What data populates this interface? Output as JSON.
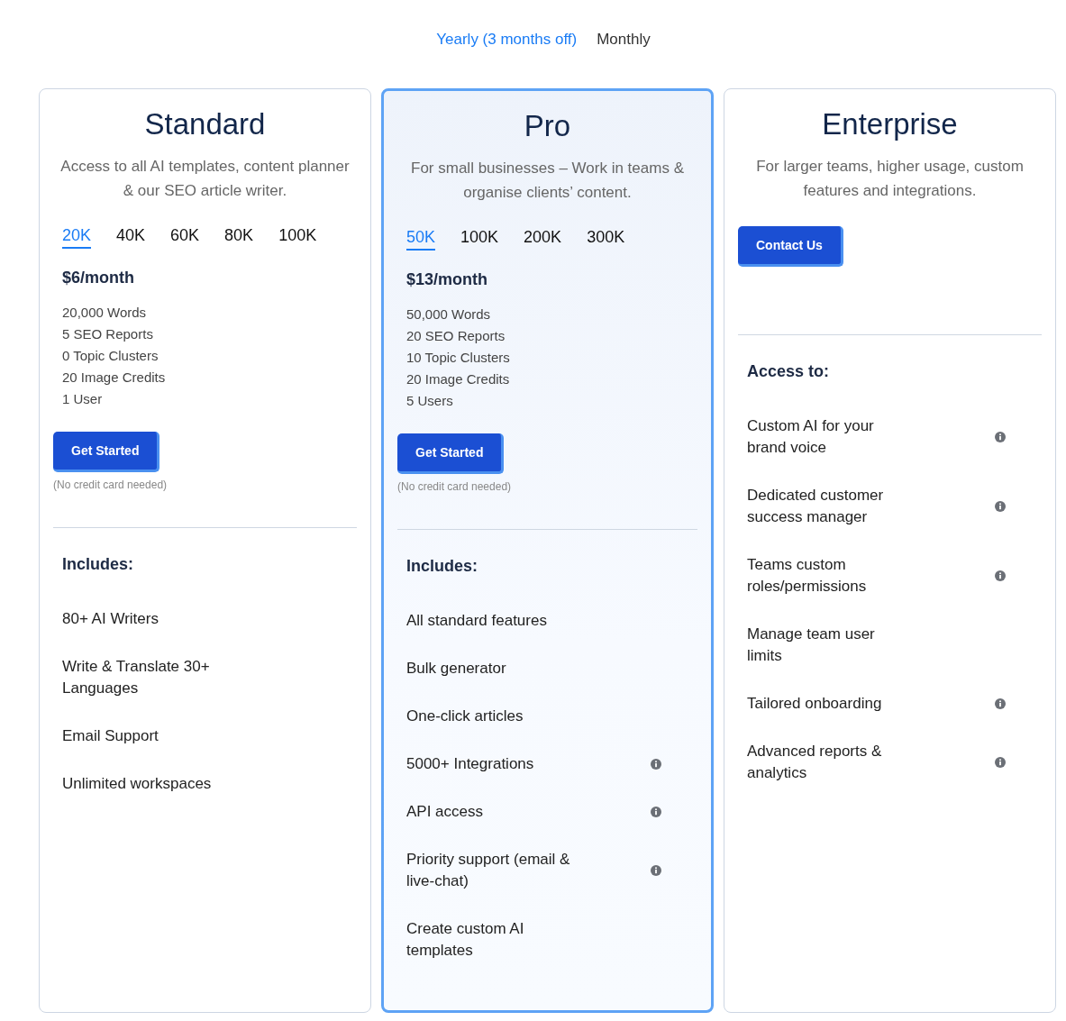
{
  "billing": [
    {
      "label": "Yearly (3 months off)",
      "selected": true
    },
    {
      "label": "Monthly",
      "selected": false
    }
  ],
  "plans": [
    {
      "name": "Standard",
      "featured": false,
      "description": "Access to all AI templates, content planner & our SEO article writer.",
      "tiers": [
        {
          "label": "20K",
          "selected": true
        },
        {
          "label": "40K",
          "selected": false
        },
        {
          "label": "60K",
          "selected": false
        },
        {
          "label": "80K",
          "selected": false
        },
        {
          "label": "100K",
          "selected": false
        }
      ],
      "price": "$6/month",
      "quotas": [
        "20,000 Words",
        "5 SEO Reports",
        "0 Topic Clusters",
        "20 Image Credits",
        "1 User"
      ],
      "button": "Get Started",
      "note": "(No credit card needed)",
      "section": "Includes:",
      "features": [
        {
          "label": "80+ AI Writers",
          "info": false
        },
        {
          "label": "Write & Translate 30+ Languages",
          "info": false
        },
        {
          "label": "Email Support",
          "info": false
        },
        {
          "label": "Unlimited workspaces",
          "info": false
        }
      ]
    },
    {
      "name": "Pro",
      "featured": true,
      "description": "For small businesses – Work in teams & organise clients’ content.",
      "tiers": [
        {
          "label": "50K",
          "selected": true
        },
        {
          "label": "100K",
          "selected": false
        },
        {
          "label": "200K",
          "selected": false
        },
        {
          "label": "300K",
          "selected": false
        }
      ],
      "price": "$13/month",
      "quotas": [
        "50,000 Words",
        "20 SEO Reports",
        "10 Topic Clusters",
        "20 Image Credits",
        "5 Users"
      ],
      "button": "Get Started",
      "note": "(No credit card needed)",
      "section": "Includes:",
      "features": [
        {
          "label": "All standard features",
          "info": false
        },
        {
          "label": "Bulk generator",
          "info": false
        },
        {
          "label": "One-click articles",
          "info": false
        },
        {
          "label": "5000+ Integrations",
          "info": true
        },
        {
          "label": "API access",
          "info": true
        },
        {
          "label": "Priority support (email & live-chat)",
          "info": true
        },
        {
          "label": "Create custom AI templates",
          "info": false
        }
      ]
    },
    {
      "name": "Enterprise",
      "featured": false,
      "description": "For larger teams, higher usage, custom features and integrations.",
      "button": "Contact Us",
      "section": "Access to:",
      "features": [
        {
          "label": "Custom AI for your brand voice",
          "info": true
        },
        {
          "label": "Dedicated customer success manager",
          "info": true
        },
        {
          "label": "Teams custom roles/permissions",
          "info": true
        },
        {
          "label": "Manage team user limits",
          "info": false
        },
        {
          "label": "Tailored onboarding",
          "info": true
        },
        {
          "label": "Advanced reports & analytics",
          "info": true
        }
      ]
    }
  ]
}
